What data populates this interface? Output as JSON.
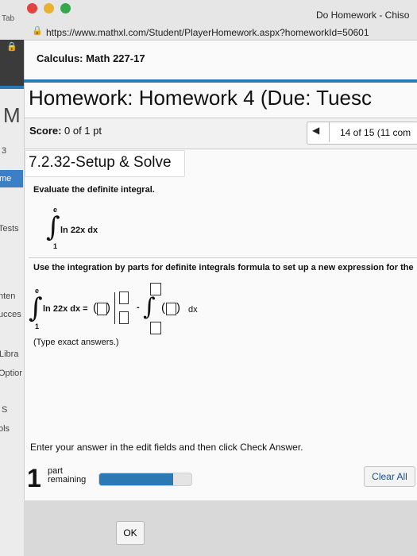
{
  "browser": {
    "tab_label": "Tab",
    "window_title": "Do Homework - Chiso",
    "url": "https://www.mathxl.com/Student/PlayerHomework.aspx?homeworkId=50601"
  },
  "sidebar": {
    "items": [
      "M",
      "3",
      "me",
      "Tests",
      "nten",
      "ucces",
      "Libra",
      "Optior",
      "S",
      "ols"
    ]
  },
  "course": {
    "title": "Calculus: Math 227-17"
  },
  "homework": {
    "title": "Homework: Homework 4 (Due: Tuesc",
    "score_label": "Score:",
    "score_value": "0 of 1 pt",
    "question_position": "14 of 15 (11 com",
    "problem_id": "7.2.32-Setup & Solve"
  },
  "question": {
    "instruction": "Evaluate the definite integral.",
    "integral": {
      "upper": "e",
      "lower": "1",
      "integrand": "ln 22x dx"
    },
    "setup_instruction": "Use the integration by parts for definite integrals formula to set up a new expression for the",
    "setup": {
      "upper": "e",
      "lower": "1",
      "lhs": "ln 22x dx =",
      "minus": "-",
      "dx": "dx"
    },
    "hint": "(Type exact answers.)"
  },
  "footer": {
    "instruction": "Enter your answer in the edit fields and then click Check Answer.",
    "parts_number": "1",
    "parts_label_line1": "part",
    "parts_label_line2": "remaining",
    "progress_fraction": 0.8,
    "clear_all_label": "Clear All",
    "ok_label": "OK"
  },
  "colors": {
    "accent": "#2a78b4",
    "traffic_red": "#e0463f",
    "traffic_yellow": "#e8b230",
    "traffic_green": "#34a84a"
  }
}
